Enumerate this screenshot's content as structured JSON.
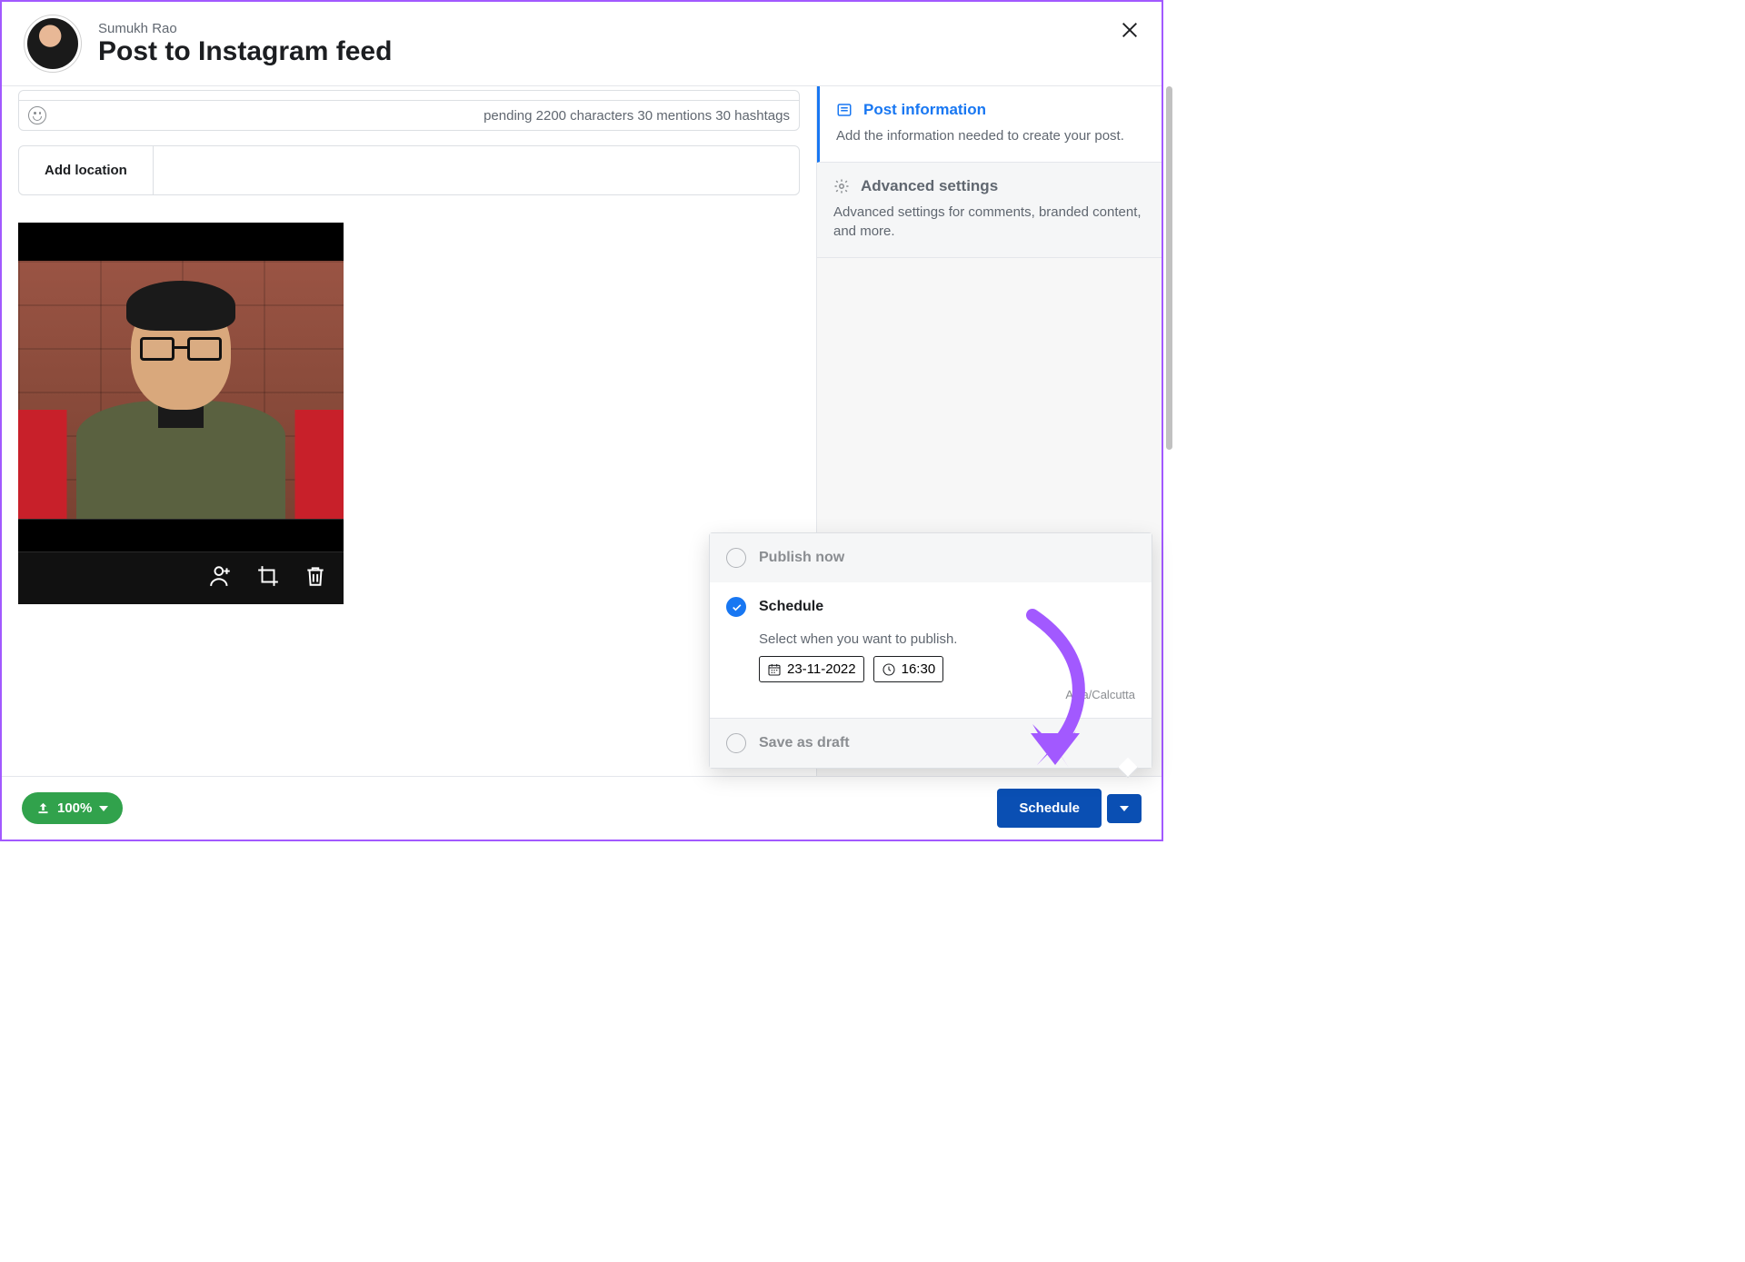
{
  "header": {
    "user": "Sumukh Rao",
    "title": "Post to Instagram feed"
  },
  "caption": {
    "status": "pending 2200 characters 30 mentions 30 hashtags"
  },
  "location": {
    "button": "Add location"
  },
  "sidebar": {
    "post_info": {
      "title": "Post information",
      "desc": "Add the information needed to create your post."
    },
    "advanced": {
      "title": "Advanced settings",
      "desc": "Advanced settings for comments, branded content, and more."
    }
  },
  "schedule_popover": {
    "publish_now": "Publish now",
    "schedule": "Schedule",
    "desc": "Select when you want to publish.",
    "date": "23-11-2022",
    "time": "16:30",
    "timezone": "Asia/Calcutta",
    "save_draft": "Save as draft"
  },
  "footer": {
    "upload": "100%",
    "schedule_btn": "Schedule"
  }
}
